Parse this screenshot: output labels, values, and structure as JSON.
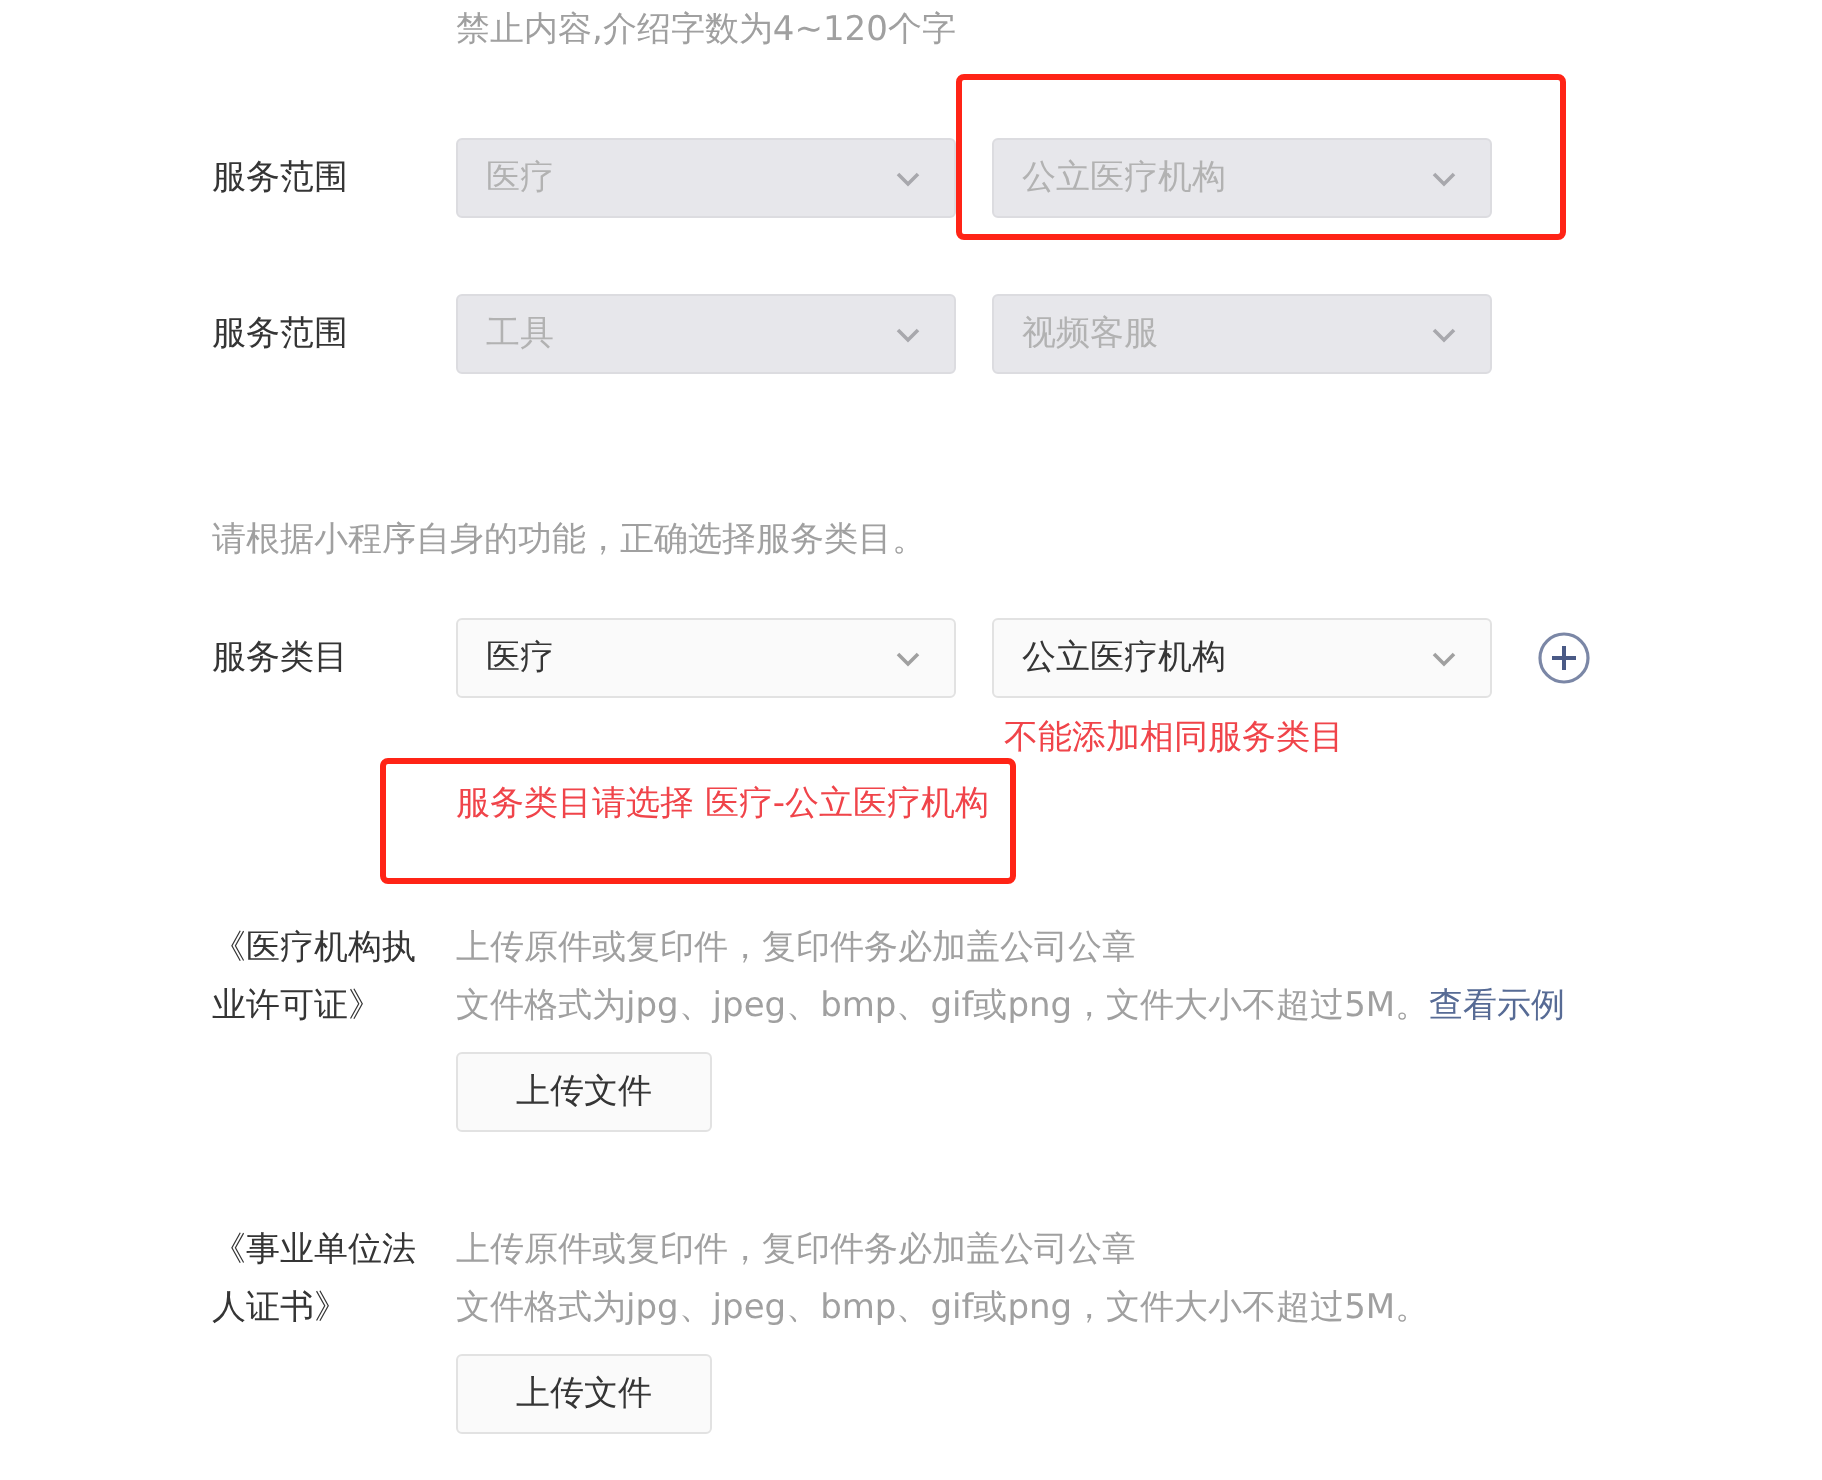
{
  "intro_hint": "禁止内容,介绍字数为4~120个字",
  "service_scope_rows": [
    {
      "label": "服务范围",
      "selects": [
        {
          "value": "医疗",
          "disabled": true,
          "highlighted": false
        },
        {
          "value": "公立医疗机构",
          "disabled": true,
          "highlighted": true
        }
      ]
    },
    {
      "label": "服务范围",
      "selects": [
        {
          "value": "工具",
          "disabled": true,
          "highlighted": false
        },
        {
          "value": "视频客服",
          "disabled": true,
          "highlighted": false
        }
      ]
    }
  ],
  "category_instruction": "请根据小程序自身的功能，正确选择服务类目。",
  "category_row": {
    "label": "服务类目",
    "selects": [
      {
        "value": "医疗",
        "disabled": false,
        "highlighted": false
      },
      {
        "value": "公立医疗机构",
        "disabled": false,
        "highlighted": false
      }
    ]
  },
  "duplicate_error": {
    "text": "不能添加相同服务类目",
    "highlighted": false
  },
  "selection_error": {
    "text": "服务类目请选择 医疗-公立医疗机构",
    "highlighted": true
  },
  "certificates": [
    {
      "label": "《医疗机构执业许可证》",
      "line_1": "上传原件或复印件，复印件务必加盖公司公章",
      "line_2": "文件格式为jpg、jpeg、bmp、gif或png，文件大小不超过5M。",
      "link": "查看示例",
      "button": "上传文件"
    },
    {
      "label": "《事业单位法人证书》",
      "line_1": "上传原件或复印件，复印件务必加盖公司公章",
      "line_2": "文件格式为jpg、jpeg、bmp、gif或png，文件大小不超过5M。",
      "button": "上传文件"
    }
  ]
}
